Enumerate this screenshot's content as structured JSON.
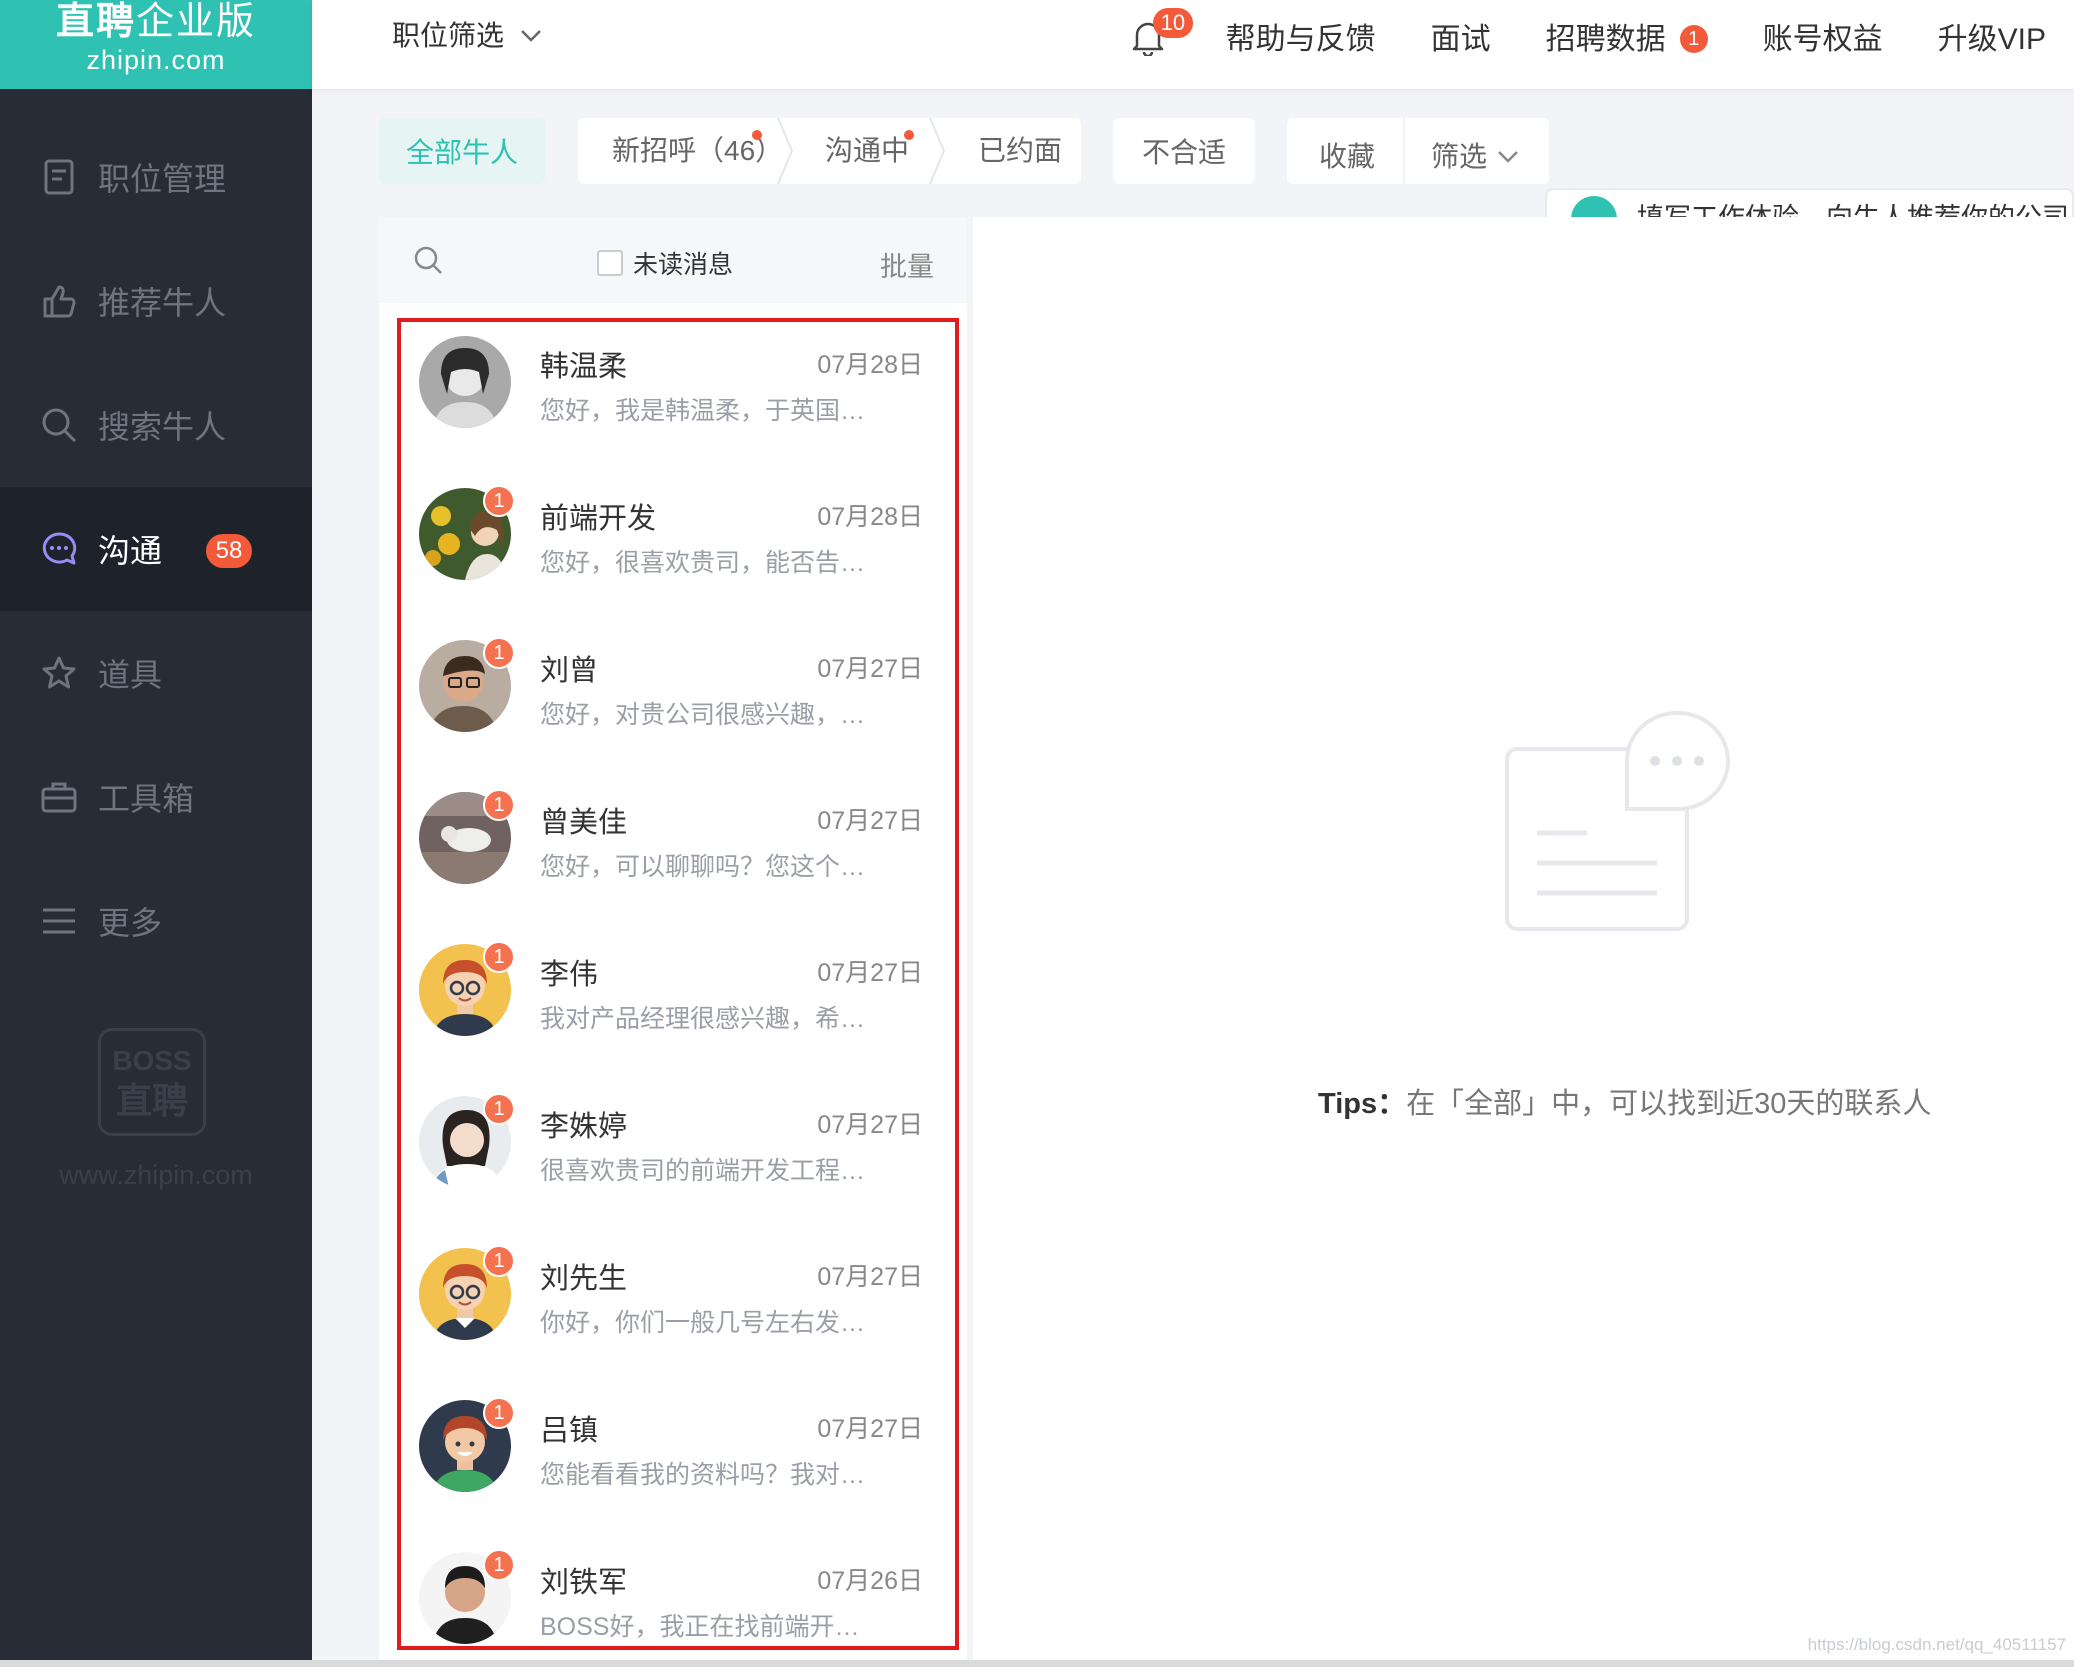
{
  "sidebar": {
    "logo_main_bold": "直聘",
    "logo_main_rest": "企业版",
    "logo_sub": "zhipin.com",
    "items": [
      {
        "label": "职位管理",
        "icon": "document-icon"
      },
      {
        "label": "推荐牛人",
        "icon": "thumbs-up-icon"
      },
      {
        "label": "搜索牛人",
        "icon": "search-icon"
      },
      {
        "label": "沟通",
        "icon": "chat-icon",
        "badge": "58",
        "active": true
      },
      {
        "label": "道具",
        "icon": "star-icon"
      },
      {
        "label": "工具箱",
        "icon": "briefcase-icon"
      },
      {
        "label": "更多",
        "icon": "menu-icon"
      }
    ],
    "watermark_line1": "BOSS",
    "watermark_line2": "直聘",
    "watermark_url": "www.zhipin.com"
  },
  "topbar": {
    "job_filter": "职位筛选",
    "bell_badge": "10",
    "help": "帮助与反馈",
    "interview": "面试",
    "recruit_data": "招聘数据",
    "recruit_data_badge": "1",
    "account": "账号权益",
    "vip": "升级VIP"
  },
  "tabs": {
    "all": "全部牛人",
    "new_greet": "新招呼（46）",
    "communicating": "沟通中",
    "interview_set": "已约面",
    "unsuitable": "不合适",
    "favorites": "收藏",
    "filter": "筛选"
  },
  "list": {
    "unread_label": "未读消息",
    "batch": "批量",
    "conversations": [
      {
        "name": "韩温柔",
        "date": "07月28日",
        "msg": "您好，我是韩温柔，于英国…",
        "unread": ""
      },
      {
        "name": "前端开发",
        "date": "07月28日",
        "msg": "您好，很喜欢贵司，能否告…",
        "unread": "1"
      },
      {
        "name": "刘曾",
        "date": "07月27日",
        "msg": "您好，对贵公司很感兴趣，…",
        "unread": "1"
      },
      {
        "name": "曾美佳",
        "date": "07月27日",
        "msg": "您好，可以聊聊吗？您这个…",
        "unread": "1"
      },
      {
        "name": "李伟",
        "date": "07月27日",
        "msg": "我对产品经理很感兴趣，希…",
        "unread": "1"
      },
      {
        "name": "李姝婷",
        "date": "07月27日",
        "msg": "很喜欢贵司的前端开发工程…",
        "unread": "1"
      },
      {
        "name": "刘先生",
        "date": "07月27日",
        "msg": "你好，你们一般几号左右发…",
        "unread": "1"
      },
      {
        "name": "吕镇",
        "date": "07月27日",
        "msg": "您能看看我的资料吗？我对…",
        "unread": "1"
      },
      {
        "name": "刘铁军",
        "date": "07月26日",
        "msg": "BOSS好，我正在找前端开…",
        "unread": "1"
      }
    ]
  },
  "right": {
    "promo_text": "填写工作体验，向牛人推荐你的公司",
    "tips_label": "Tips：",
    "tips_text": "在「全部」中，可以找到近30天的联系人"
  },
  "footer": {
    "csdn": "https://blog.csdn.net/qq_40511157"
  },
  "colors": {
    "brand": "#2fc1b2",
    "badge": "#f25a3a",
    "sidebar": "#272c36",
    "frame": "#e01a1f"
  }
}
